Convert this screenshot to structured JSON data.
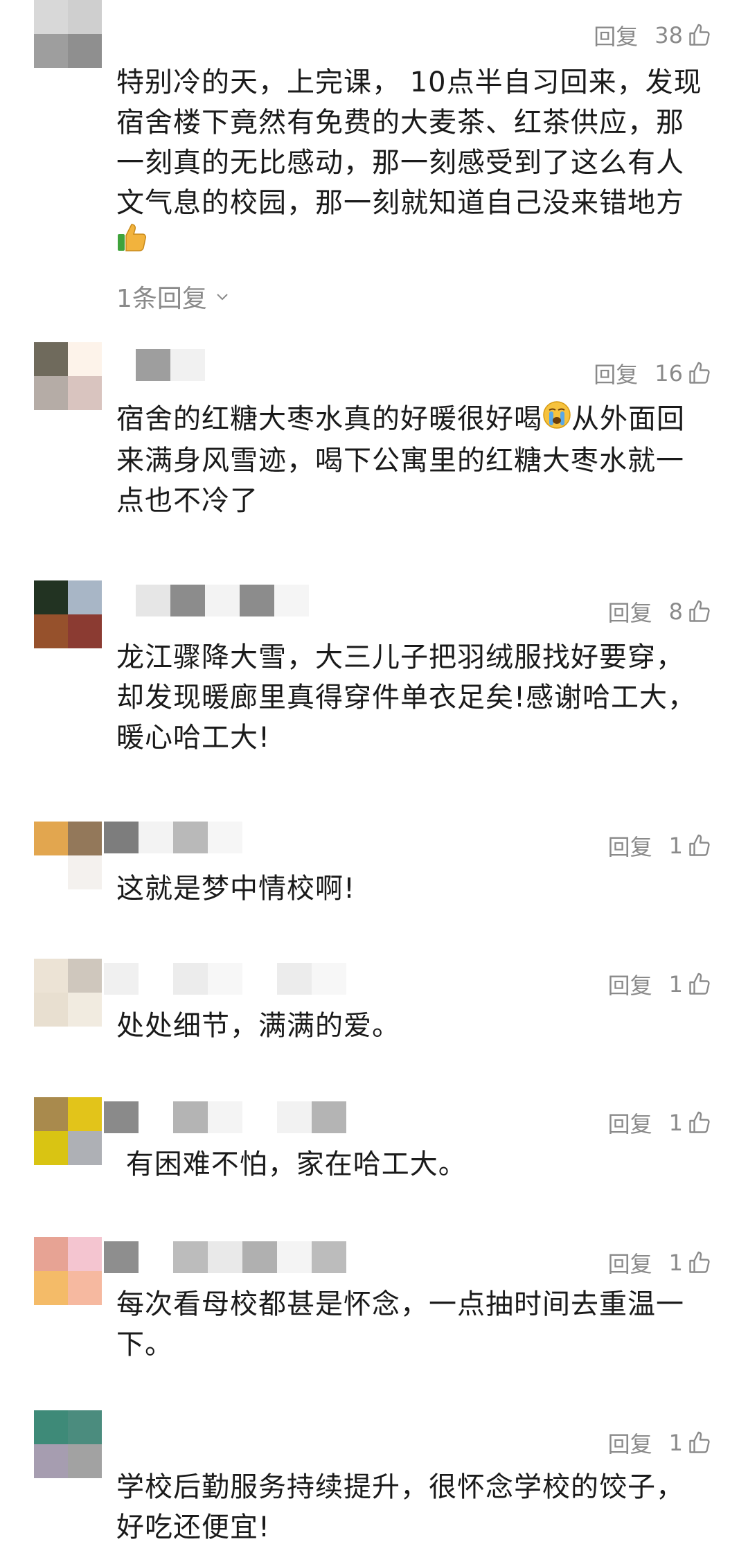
{
  "comments": [
    {
      "reply_label": "回复",
      "likes": "38",
      "text": "特别冷的天，上完课， 10点半自习回来，发现宿舍楼下竟然有免费的大麦茶、红茶供应，那一刻真的无比感动，那一刻感受到了这么有人文气息的校园，那一刻就知道自己没来错地方",
      "emoji": "thumbs-up-emoji",
      "sub_replies": "1条回复",
      "avatar_colors": [
        "#d8d8d8",
        "#cfcfcf",
        "#9e9e9e",
        "#8f8f8f"
      ]
    },
    {
      "reply_label": "回复",
      "likes": "16",
      "text_before_emoji": "宿舍的红糖大枣水真的好暖很好喝",
      "emoji": "crying-face-emoji",
      "text_after_emoji": "从外面回来满身风雪迹，喝下公寓里的红糖大枣水就一点也不冷了",
      "avatar_colors": [
        "#6f6a5c",
        "#fdf3ea",
        "#b5aca6",
        "#d9c4bf"
      ]
    },
    {
      "reply_label": "回复",
      "likes": "8",
      "text": "龙江骤降大雪，大三儿子把羽绒服找好要穿，却发现暖廊里真得穿件单衣足矣!感谢哈工大，暖心哈工大!",
      "avatar_colors": [
        "#223322",
        "#a8b6c6",
        "#96512c",
        "#8b3b32"
      ]
    },
    {
      "reply_label": "回复",
      "likes": "1",
      "text": "这就是梦中情校啊!",
      "avatar_colors": [
        "#e2a64f",
        "#93785a",
        "#ffffff",
        "#f4f1ee"
      ]
    },
    {
      "reply_label": "回复",
      "likes": "1",
      "text": "处处细节，满满的爱。",
      "avatar_colors": [
        "#ece3d5",
        "#cfc7bd",
        "#e8dfd0",
        "#f1ebe0"
      ]
    },
    {
      "reply_label": "回复",
      "likes": "1",
      "text": " 有困难不怕，家在哈工大。",
      "avatar_colors": [
        "#a98a4d",
        "#e2c41a",
        "#d9c413",
        "#aeb0b5"
      ]
    },
    {
      "reply_label": "回复",
      "likes": "1",
      "text": "每次看母校都甚是怀念，一点抽时间去重温一下。",
      "avatar_colors": [
        "#e7a394",
        "#f4c5d0",
        "#f4bb68",
        "#f6b9a0"
      ]
    },
    {
      "reply_label": "回复",
      "likes": "1",
      "text": "学校后勤服务持续提升，很怀念学校的饺子，好吃还便宜!",
      "avatar_colors": [
        "#3e8a78",
        "#4b8c7e",
        "#a69db0",
        "#a2a2a2"
      ]
    }
  ]
}
